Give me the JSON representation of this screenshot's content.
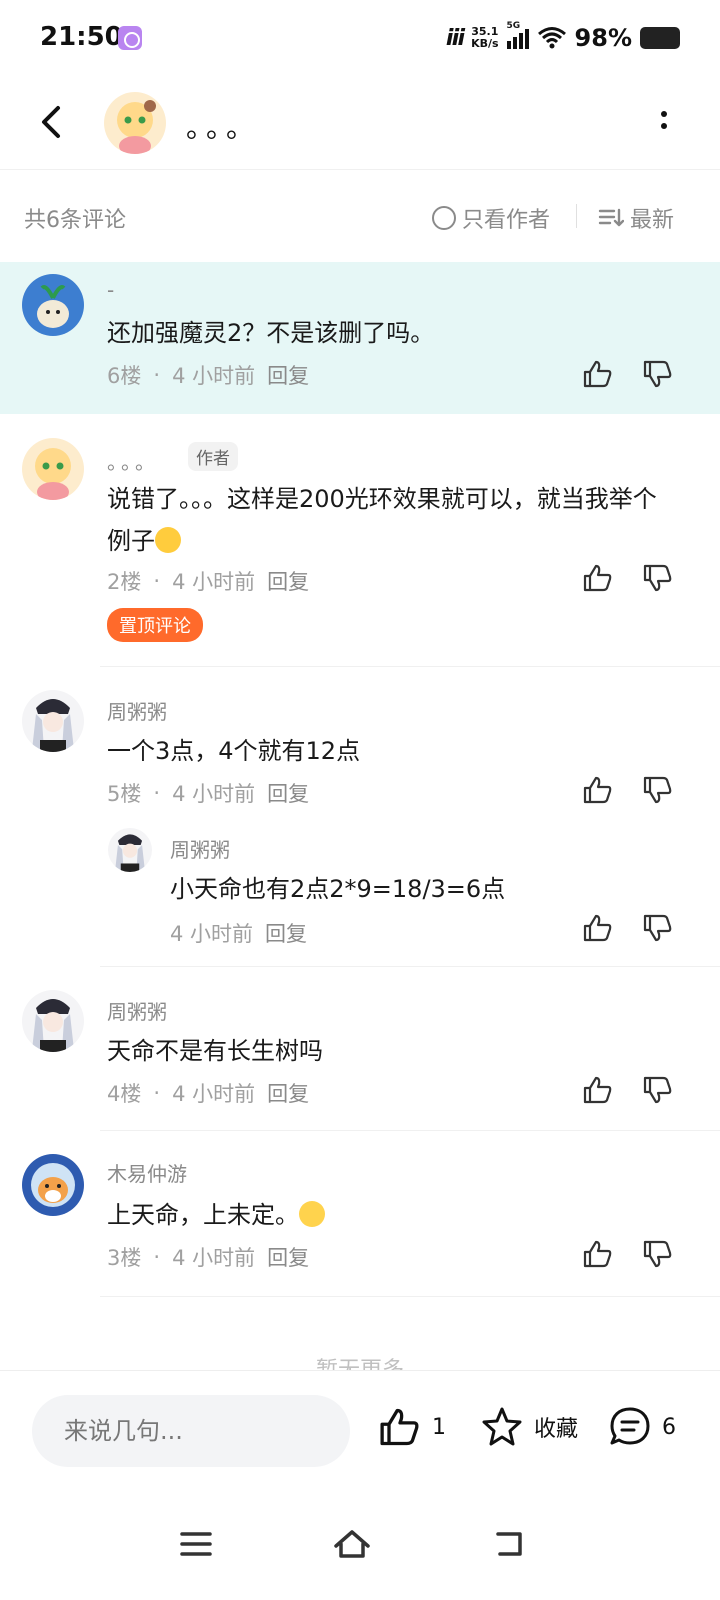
{
  "status_bar": {
    "time": "21:50",
    "speed_value": "35.1",
    "speed_unit": "KB/s",
    "network": "5G",
    "battery": "98%"
  },
  "header": {
    "title": "。。。",
    "icons": {
      "back": "chevron-left-icon",
      "more": "more-vertical-icon"
    }
  },
  "filter": {
    "count_label": "共6条评论",
    "author_only_label": "只看作者",
    "sort_label": "最新"
  },
  "comments": [
    {
      "name": "-",
      "text": "还加强魔灵2？不是该删了吗。",
      "floor": "6楼",
      "time": "4 小时前",
      "reply": "回复"
    },
    {
      "name": "。。。",
      "author_tag": "作者",
      "text": "说错了。。。这样是200光环效果就可以，就当我举个例子",
      "floor": "2楼",
      "time": "4 小时前",
      "reply": "回复",
      "badge": "置顶评论"
    },
    {
      "name": "周粥粥",
      "text": "一个3点，4个就有12点",
      "floor": "5楼",
      "time": "4 小时前",
      "reply": "回复",
      "sub_reply": {
        "name": "周粥粥",
        "text": "小天命也有2点2*9=18/3=6点",
        "time": "4 小时前",
        "reply": "回复"
      }
    },
    {
      "name": "周粥粥",
      "text": "天命不是有长生树吗",
      "floor": "4楼",
      "time": "4 小时前",
      "reply": "回复"
    },
    {
      "name": "木易仲游",
      "text": "上天命，上未定。",
      "floor": "3楼",
      "time": "4 小时前",
      "reply": "回复"
    }
  ],
  "no_more": "暂无更多",
  "bottom_bar": {
    "input_placeholder": "来说几句...",
    "like_count": "1",
    "favorite_label": "收藏",
    "comment_count": "6"
  },
  "colors": {
    "highlight_bg": "#e6f7f6",
    "pin_badge": "#ff6a2b",
    "muted_text": "#8a8a8a"
  }
}
